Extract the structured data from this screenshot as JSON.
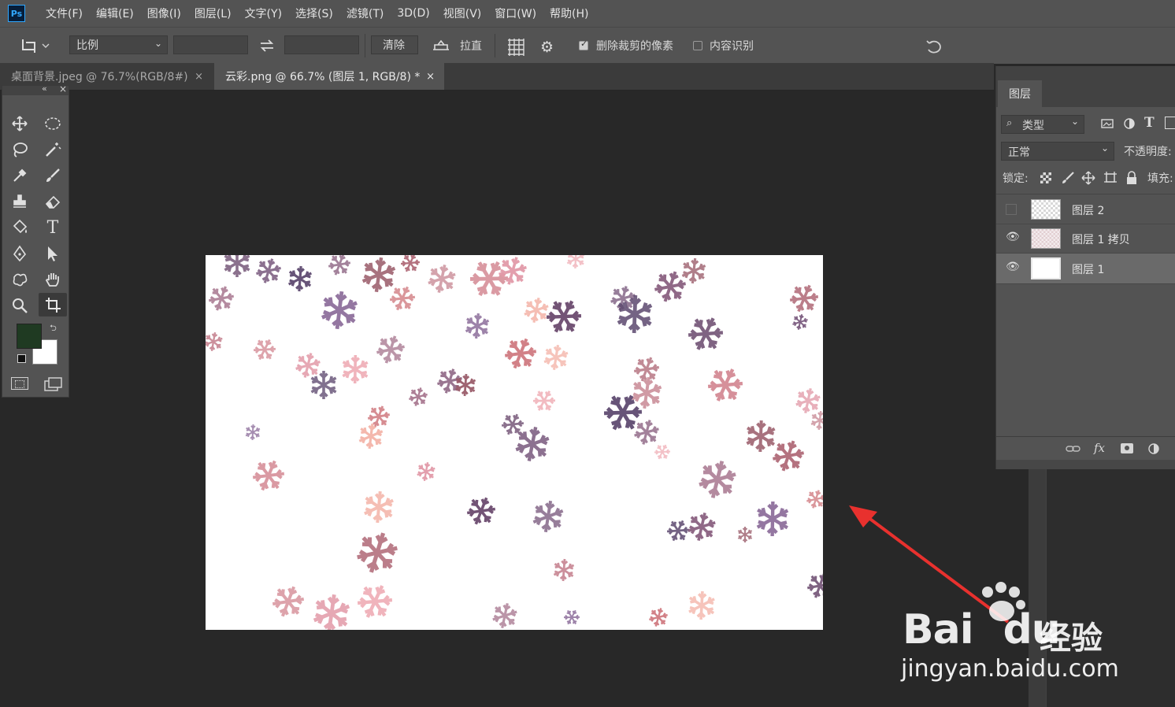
{
  "app": {
    "logo_text": "Ps"
  },
  "menu": [
    "文件(F)",
    "编辑(E)",
    "图像(I)",
    "图层(L)",
    "文字(Y)",
    "选择(S)",
    "滤镜(T)",
    "3D(D)",
    "视图(V)",
    "窗口(W)",
    "帮助(H)"
  ],
  "options": {
    "ratio_select": "比例",
    "ratio_w": "",
    "ratio_h": "",
    "clear_label": "清除",
    "straighten_label": "拉直",
    "delete_cropped_label": "删除裁剪的像素",
    "delete_cropped_checked": true,
    "content_aware_label": "内容识别",
    "content_aware_checked": false
  },
  "tabs": [
    {
      "label": "桌面背景.jpeg @ 76.7%(RGB/8#)",
      "close": "×",
      "active": false
    },
    {
      "label": "云彩.png @ 66.7% (图层 1, RGB/8) *",
      "close": "×",
      "active": true
    }
  ],
  "toolbox": {
    "collapse": "«",
    "close": "×",
    "foreground_color": "#1f3a22",
    "background_color": "#ffffff"
  },
  "layers_panel": {
    "tab_label": "图层",
    "filter_label": "类型",
    "blend_mode": "正常",
    "opacity_label": "不透明度:",
    "lock_label": "锁定:",
    "fill_label": "填充:",
    "layers": [
      {
        "name": "图层 2",
        "visible": false,
        "selected": false
      },
      {
        "name": "图层 1 拷贝",
        "visible": true,
        "selected": false
      },
      {
        "name": "图层 1",
        "visible": true,
        "selected": true
      }
    ],
    "footer_fx": "fx"
  },
  "watermark": {
    "brand": "Bai",
    "brand2": "du",
    "brand_cn": "经验",
    "url": "jingyan.baidu.com"
  },
  "colors": {
    "accent_ps": "#31a8ff",
    "arrow": "#e8312e"
  }
}
